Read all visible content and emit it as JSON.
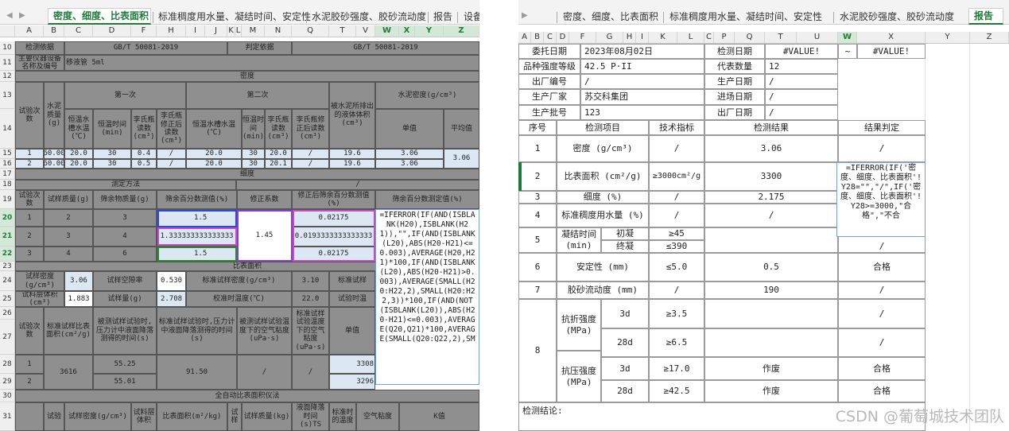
{
  "left": {
    "nav_prev": "◀",
    "nav_next": "▶",
    "tabs": [
      "密度、细度、比表面积",
      "标准稠度用水量、凝结时间、安定性",
      "水泥胶砂强度、胶砂流动度",
      "报告",
      "设备"
    ],
    "active_tab": 0,
    "col_headers": [
      "A",
      "B",
      "C",
      "D",
      "F",
      "H",
      "I",
      "J",
      "K",
      "L",
      "M",
      "N",
      "Q",
      "T",
      "V",
      "W",
      "X",
      "Y",
      "Z"
    ],
    "row_numbers": [
      "10",
      "11",
      "12",
      "13",
      "14",
      "15",
      "16",
      "17",
      "18",
      "19",
      "20",
      "21",
      "22",
      "23",
      "24",
      "25",
      "26",
      "27",
      "28",
      "29",
      "30",
      "31"
    ],
    "cells": {
      "test_basis_label": "检测依据",
      "test_basis": "GB/T 50081-2019",
      "judge_basis_label": "判定依据",
      "judge_basis": "GB/T 50081-2019",
      "main_equip_label": "主要仪器设备名称及编号",
      "main_equip": "移液管 5ml",
      "density": "密度",
      "first": "第一次",
      "second": "第二次",
      "cement_density_hdr": "水泥密度(g/cm³)",
      "trial_count": "试验次数",
      "cement_mass": "水泥质量(g)",
      "const_temp_water1": "恒温水槽水温(℃)",
      "const_temp_time": "恒温时间(min)",
      "le_reading": "李氏瓶读数(cm³)",
      "le_corr": "李氏瓶修正后读数(cm³)",
      "const_temp_water2": "恒温水槽水温(℃)",
      "const_temp_time2": "恒温时间(min)",
      "le_reading2": "李氏瓶读数(cm³)",
      "le_corr2": "李氏瓶修正后读数(cm³)",
      "displaced_vol": "被水泥所排出的液体体积(cm³)",
      "single_val": "单值",
      "avg_val": "平均值",
      "r15": [
        "1",
        "60.00",
        "20.0",
        "30",
        "0.4",
        "/",
        "20.0",
        "30",
        "20.0",
        "/",
        "19.6",
        "3.06"
      ],
      "r16": [
        "2",
        "60.00",
        "20.0",
        "30",
        "0.5",
        "/",
        "20.0",
        "30",
        "20.1",
        "/",
        "19.6",
        "3.06"
      ],
      "density_avg": "3.06",
      "fineness": "细度",
      "method": "测定方法",
      "sample_mass": "试样质量(g)",
      "residue_mass": "筛余物质量(g)",
      "residue_pct": "筛余百分数测值(%)",
      "corr_factor": "修正系数",
      "corr_residue": "修正后筛余百分数测值(%)",
      "residue_result": "筛余百分数测定值(%)",
      "r20": [
        "1",
        "2",
        "3",
        "1.5",
        "0.02175"
      ],
      "r21": [
        "2",
        "3",
        "4",
        "1.333333333333333",
        "1.45",
        "0.0193333333333333"
      ],
      "r22": [
        "3",
        "4",
        "6",
        "1.5",
        "0.02175"
      ],
      "specific_surface": "比表面积",
      "sample_density": "试样密度(g/cm³)",
      "sample_density_val": "3.06",
      "sample_porosity": "试样空隙率",
      "sample_porosity_val": "0.530",
      "std_density": "标准试样密度(g/cm³)",
      "std_density_val": "3.10",
      "std_trunc": "标准试样",
      "bed_volume": "试料层体积(cm³)",
      "bed_volume_val": "1.883",
      "sample_weight": "试样量(g)",
      "sample_weight_val": "2.708",
      "calib_temp": "校准时温度(℃)",
      "calib_temp_val": "22.0",
      "test_temp_trunc": "试验时温",
      "std_surface": "标准试样比表面积(cm²/g)",
      "press_time1": "被测试样试验时,压力计中液面降落测得的时间(s)",
      "press_time2": "标准试样试验时,压力计中液面降落测得的时间(s)",
      "air_visc1": "被测试样试验温度下的空气粘度(uPa·s)",
      "air_visc2": "标准试样试验温度下的空气粘度(uPa·s)",
      "single_trunc": "单值",
      "std_surface_val": "3616",
      "t28": "55.25",
      "t29": "55.01",
      "std_time_val": "91.50",
      "slash": "/",
      "v28": "3308",
      "v29": "3296",
      "auto_title": "全自动比表面积仪法",
      "r31_trial": "试验",
      "r31_density": "试样密度(g/cm³)",
      "r31_bed": "试料层体积",
      "r31_area": "比表面积(m²/kg)",
      "r31_trial2": "试样",
      "r31_mass": "试样质量(kg)",
      "r31_drop": "液面降落时间(s)TS",
      "r31_std": "标准时的温度",
      "r31_visc": "空气粘度",
      "r31_k": "K值",
      "formula": "=IFERROR(IF(AND(ISBLANK(H20),ISBLANK(H21)),\"\",IF(AND(ISBLANK(L20),ABS(H20-H21)<=0.003),AVERAGE(H20,H21)*100,IF(AND(ISBLANK(L20),ABS(H20-H21)>0.003),AVERAGE(SMALL(H20:H22,2),SMALL(H20:H22,3))*100,IF(AND(NOT(ISBLANK(L20)),ABS(H20-H21)<=0.003),AVERAGE(Q20,Q21)*100,AVERAGE(SMALL(Q20:Q22,2),SM"
    }
  },
  "right": {
    "nav": "▶",
    "tabs": [
      "密度、细度、比表面积",
      "标准稠度用水量、凝结时间、安定性",
      "水泥胶砂强度、胶砂流动度",
      "报告"
    ],
    "active_tab": 3,
    "col_headers": [
      "A",
      "B",
      "C",
      "D",
      "F",
      "G",
      "H",
      "I",
      "K",
      "L",
      "C",
      "P",
      "Q",
      "T",
      "U",
      "W",
      "X",
      "Y",
      "Z"
    ],
    "info": {
      "commission_date_label": "委托日期",
      "commission_date": "2023年08月02日",
      "test_date_label": "检测日期",
      "test_date_value1": "#VALUE!",
      "tilde": "~",
      "test_date_value2": "#VALUE!",
      "grade_label": "品种强度等级",
      "grade": "42.5 P·II",
      "rep_qty_label": "代表数量",
      "rep_qty": "12",
      "factory_no_label": "出厂编号",
      "factory_no": "/",
      "prod_date_label": "生产日期",
      "prod_date": "/",
      "maker_label": "生产厂家",
      "maker": "苏交科集团",
      "entry_date_label": "进场日期",
      "entry_date": "/",
      "batch_label": "生产批号",
      "batch": "123",
      "out_date_label": "出厂日期",
      "out_date": "/"
    },
    "table_header": [
      "序号",
      "检测项目",
      "技术指标",
      "检测结果",
      "结果判定"
    ],
    "rows": [
      {
        "no": "1",
        "item": "密度 (g/cm³)",
        "spec": "/",
        "result": "3.06",
        "judge": "/"
      },
      {
        "no": "2",
        "item": "比表面积 (cm²/g)",
        "spec": "≥3000cm²/g",
        "result": "3300",
        "judge": ""
      },
      {
        "no": "3",
        "item": "细度 (%)",
        "spec": "/",
        "result": "2.175",
        "judge": "/"
      },
      {
        "no": "4",
        "item": "标准稠度用水量 (%)",
        "spec": "/",
        "result": "/",
        "judge": "/"
      },
      {
        "no": "5",
        "item": "凝结时间 (min)",
        "sub": [
          "初凝",
          "终凝"
        ],
        "spec": [
          "≥45",
          "≤390"
        ],
        "result": "",
        "judge": "/"
      },
      {
        "no": "6",
        "item": "安定性 (mm)",
        "spec": "≤5.0",
        "result": "0.5",
        "judge": "合格"
      },
      {
        "no": "7",
        "item": "胶砂流动度 (mm)",
        "spec": "/",
        "result": "190",
        "judge": "/"
      },
      {
        "no": "8",
        "flex": "抗折强度 (MPa)",
        "comp": "抗压强度 (MPa)",
        "ages": [
          "3d",
          "28d",
          "3d",
          "28d"
        ],
        "specs": [
          "≥3.5",
          "≥6.5",
          "≥17.0",
          "≥42.5"
        ],
        "results": [
          "",
          "",
          "作废",
          "作废"
        ],
        "judges": [
          "/",
          "/",
          "合格",
          "合格"
        ]
      }
    ],
    "conclusion_label": "检测结论:",
    "formula": "=IFERROR(IF('密度、细度、比表面积'!Y28=\"\",\"/\",IF('密度、细度、比表面积'!Y28>=3000,\"合格\",\"不合",
    "watermark": "CSDN @葡萄城技术团队"
  }
}
